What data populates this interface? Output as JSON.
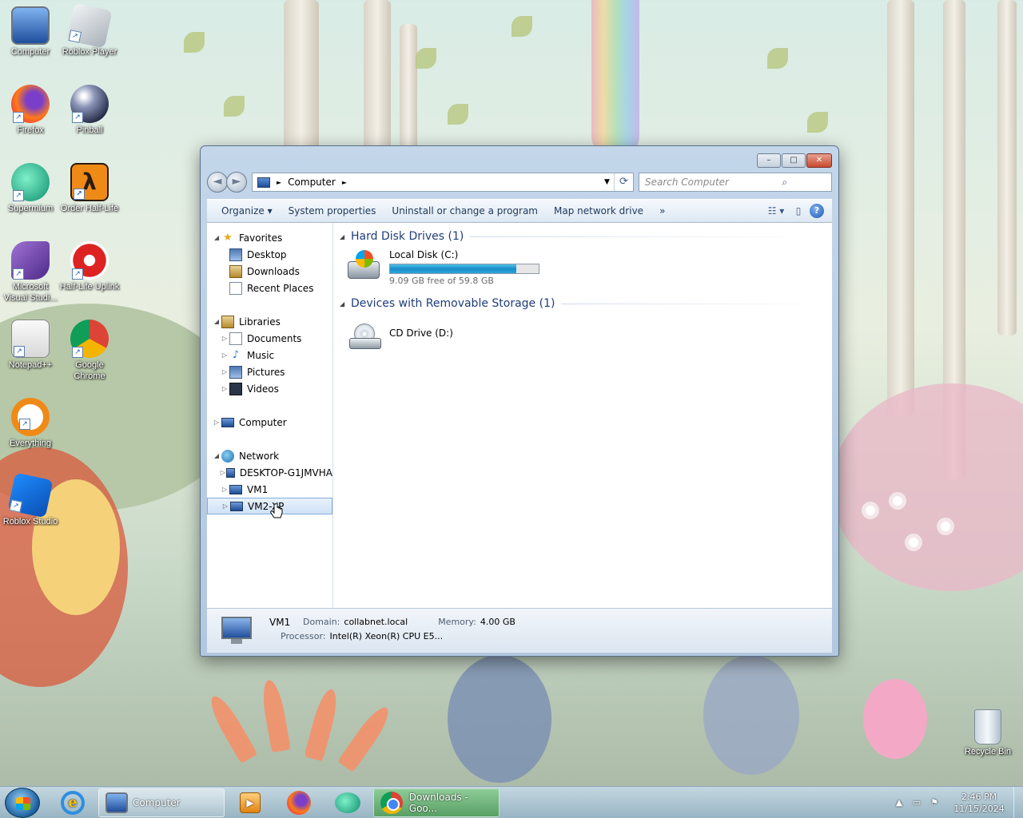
{
  "desktop": {
    "icons": [
      {
        "label": "Computer",
        "icon": "computer-icon"
      },
      {
        "label": "Roblox Player",
        "icon": "roblox-icon"
      },
      {
        "label": "Firefox",
        "icon": "firefox-icon"
      },
      {
        "label": "Pinball",
        "icon": "pinball-icon"
      },
      {
        "label": "Supermium",
        "icon": "supermium-icon"
      },
      {
        "label": "Order Half-Life",
        "icon": "half-life-icon"
      },
      {
        "label": "Microsoft Visual Studi...",
        "icon": "visual-studio-icon"
      },
      {
        "label": "Half-Life Uplink",
        "icon": "half-life-uplink-icon"
      },
      {
        "label": "Notepad++",
        "icon": "notepadpp-icon"
      },
      {
        "label": "Google Chrome",
        "icon": "chrome-icon"
      },
      {
        "label": "Everything",
        "icon": "everything-icon"
      },
      {
        "label": "Roblox Studio",
        "icon": "roblox-studio-icon"
      },
      {
        "label": "Recycle Bin",
        "icon": "recycle-bin-icon"
      }
    ]
  },
  "window": {
    "caption_buttons": {
      "minimize": "–",
      "maximize": "□",
      "close": "✕"
    },
    "nav": {
      "back": "◄",
      "forward": "►"
    },
    "address": {
      "crumb": "Computer",
      "sep": "►"
    },
    "search": {
      "placeholder": "Search Computer",
      "icon": "search-icon"
    },
    "toolbar": {
      "organize": "Organize ▾",
      "system_properties": "System properties",
      "uninstall": "Uninstall or change a program",
      "map_drive": "Map network drive",
      "more": "»",
      "help": "?"
    },
    "navpane": {
      "favorites": {
        "label": "Favorites",
        "items": [
          "Desktop",
          "Downloads",
          "Recent Places"
        ]
      },
      "libraries": {
        "label": "Libraries",
        "items": [
          "Documents",
          "Music",
          "Pictures",
          "Videos"
        ]
      },
      "computer": {
        "label": "Computer"
      },
      "network": {
        "label": "Network",
        "items": [
          "DESKTOP-G1JMVHA",
          "VM1",
          "VM2-XP"
        ]
      }
    },
    "content": {
      "hdd_group": "Hard Disk Drives (1)",
      "local_disk": {
        "name": "Local Disk (C:)",
        "free_text": "9.09 GB free of 59.8 GB",
        "used_fraction": 0.848
      },
      "removable_group": "Devices with Removable Storage (1)",
      "cd_drive": {
        "name": "CD Drive (D:)"
      }
    },
    "details": {
      "name": "VM1",
      "domain_key": "Domain:",
      "domain_val": "collabnet.local",
      "memory_key": "Memory:",
      "memory_val": "4.00 GB",
      "processor_key": "Processor:",
      "processor_val": "Intel(R) Xeon(R) CPU E5..."
    }
  },
  "taskbar": {
    "task_computer": "Computer",
    "task_downloads": "Downloads - Goo...",
    "clock_time": "2:46 PM",
    "clock_date": "11/15/2024",
    "tray_arrow": "▲"
  }
}
